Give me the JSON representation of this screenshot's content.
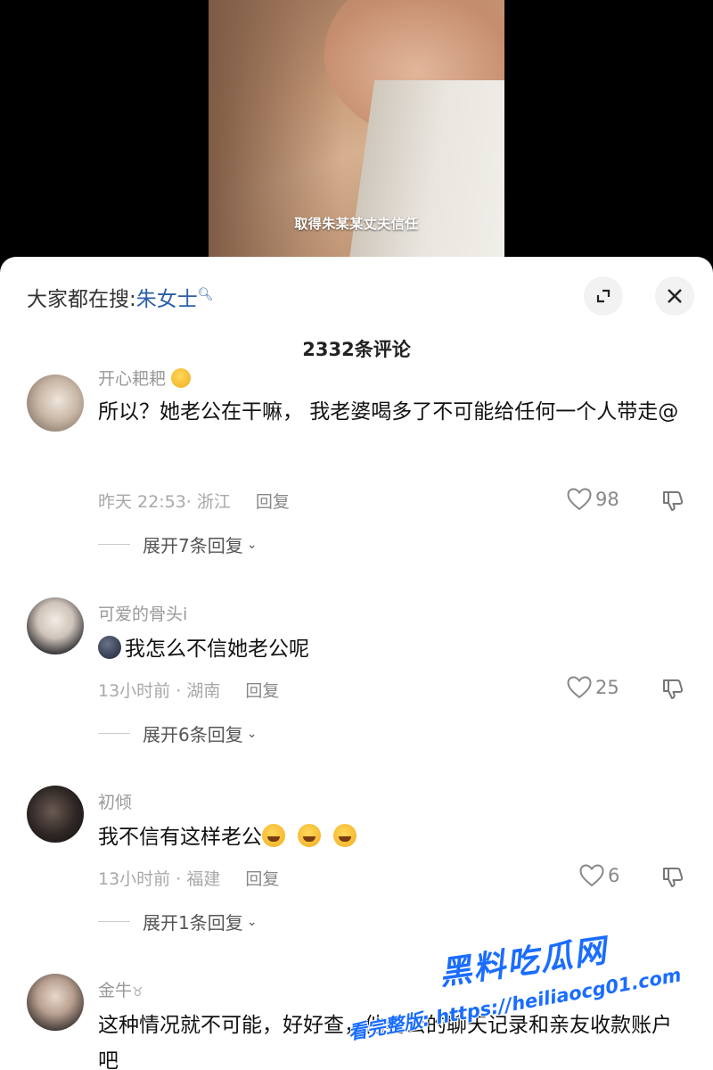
{
  "video": {
    "subtitle": "取得朱某某丈夫信任"
  },
  "header": {
    "search_prefix": "大家都在搜:",
    "search_term": "朱女士",
    "comment_count": "2332条评论"
  },
  "comments": [
    {
      "username": "开心耙耙",
      "text": "所以？她老公在干嘛， 我老婆喝多了不可能给任何一个人带走@",
      "time": "昨天 22:53",
      "location": "浙江",
      "reply_label": "回复",
      "likes": "98",
      "expand_label": "展开7条回复"
    },
    {
      "username": "可爱的骨头i",
      "text": "我怎么不信她老公呢",
      "time": "13小时前",
      "location": "湖南",
      "reply_label": "回复",
      "likes": "25",
      "expand_label": "展开6条回复"
    },
    {
      "username": "初倾",
      "text": "我不信有这样老公",
      "time": "13小时前",
      "location": "福建",
      "reply_label": "回复",
      "likes": "6",
      "expand_label": "展开1条回复"
    },
    {
      "username": "金牛",
      "text": "这种情况就不可能，好好查，他老公的聊天记录和亲友收款账户吧"
    }
  ],
  "watermark": {
    "title": "黑料吃瓜网",
    "url": "看完整版: https://heiliaocg01.com"
  },
  "colors": {
    "search_term": "#2b5fa8",
    "watermark": "#1a6dff"
  }
}
